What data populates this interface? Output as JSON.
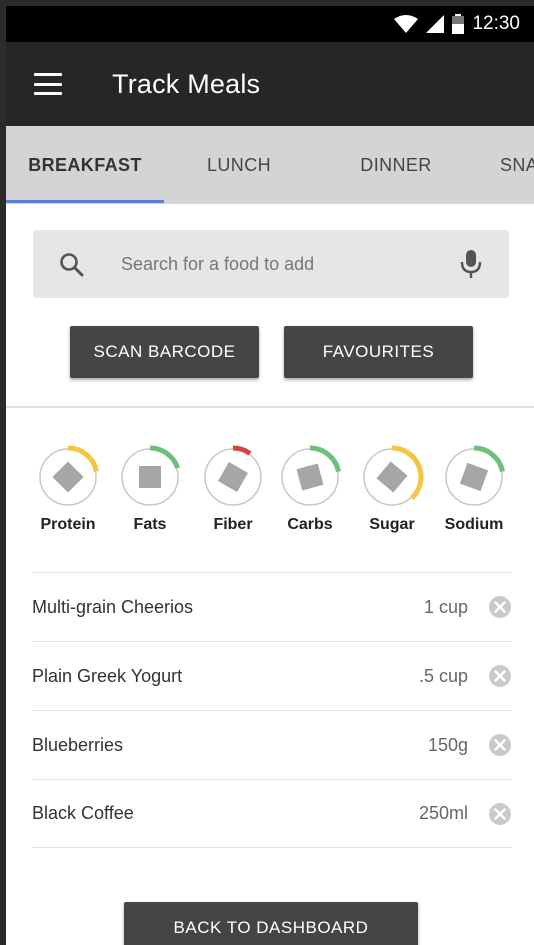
{
  "status_bar": {
    "time": "12:30"
  },
  "app_bar": {
    "title": "Track Meals"
  },
  "tabs": [
    {
      "label": "BREAKFAST",
      "active": true
    },
    {
      "label": "LUNCH",
      "active": false
    },
    {
      "label": "DINNER",
      "active": false
    },
    {
      "label": "SNA",
      "active": false
    }
  ],
  "search": {
    "placeholder": "Search for a food to add",
    "value": ""
  },
  "buttons": {
    "scan_barcode": "SCAN BARCODE",
    "favourites": "FAVOURITES",
    "back_to_dashboard": "BACK TO DASHBOARD"
  },
  "nutrients": [
    {
      "label": "Protein",
      "color": "#f5c542",
      "progress": 0.22
    },
    {
      "label": "Fats",
      "color": "#6cc07a",
      "progress": 0.2
    },
    {
      "label": "Fiber",
      "color": "#d9453a",
      "progress": 0.1
    },
    {
      "label": "Carbs",
      "color": "#6cc07a",
      "progress": 0.22
    },
    {
      "label": "Sugar",
      "color": "#f5c542",
      "progress": 0.38
    },
    {
      "label": "Sodium",
      "color": "#6cc07a",
      "progress": 0.22
    }
  ],
  "foods": [
    {
      "name": "Multi-grain Cheerios",
      "quantity": "1 cup"
    },
    {
      "name": "Plain Greek Yogurt",
      "quantity": ".5 cup"
    },
    {
      "name": "Blueberries",
      "quantity": "150g"
    },
    {
      "name": "Black Coffee",
      "quantity": "250ml"
    }
  ]
}
